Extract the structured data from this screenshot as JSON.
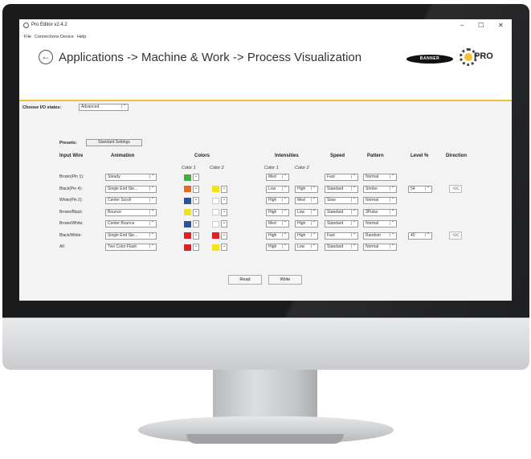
{
  "app": {
    "title": "Pro Editor v2.4.2",
    "window_controls": [
      "–",
      "☐",
      "✕"
    ],
    "menu": [
      "File",
      "Connections",
      "Device",
      "Help"
    ]
  },
  "header": {
    "breadcrumb": "Applications -> Machine & Work -> Process Visualization",
    "banner_logo": "BANNER",
    "pro_logo": "PRO",
    "accent_color": "#f1c232"
  },
  "io_states": {
    "label": "Choose I/O states:",
    "value": "Advanced"
  },
  "presets": {
    "label": "Presets:",
    "value": "Standard Settings"
  },
  "columns": {
    "input_wire": "Input Wire",
    "animation": "Animation",
    "colors": "Colors",
    "color1": "Color 1",
    "color2": "Color 2",
    "intensities": "Intensities",
    "int_color1": "Color 1",
    "int_color2": "Color 2",
    "speed": "Speed",
    "pattern": "Pattern",
    "level": "Level %",
    "direction": "Direction"
  },
  "rows": [
    {
      "wire": "Brown(Pin 1):",
      "animation": "Steady",
      "color1": "#3cb043",
      "color2": null,
      "int1": "Med",
      "int2": null,
      "speed": "Fast",
      "pattern": "Normal",
      "level": null,
      "direction": null
    },
    {
      "wire": "Black(Pin 4):",
      "animation": "Single End Ste...",
      "color1": "#e86a1e",
      "color2": "#f2e21a",
      "int1": "Low",
      "int2": "High",
      "speed": "Standard",
      "pattern": "Strobe",
      "level": "54",
      "direction": "<<"
    },
    {
      "wire": "White(Pin 2):",
      "animation": "Center Scroll",
      "color1": "#2a4fa3",
      "color2": "#ffffff",
      "int1": "High",
      "int2": "Med",
      "speed": "Slow",
      "pattern": "Normal",
      "level": null,
      "direction": null
    },
    {
      "wire": "Brown/Black:",
      "animation": "Bounce",
      "color1": "#f2e21a",
      "color2": "#ffffff",
      "int1": "High",
      "int2": "Low",
      "speed": "Standard",
      "pattern": "3Pulse",
      "level": null,
      "direction": null
    },
    {
      "wire": "Brown/White:",
      "animation": "Center Bounce",
      "color1": "#2a4fa3",
      "color2": "#ffffff",
      "int1": "Med",
      "int2": "High",
      "speed": "Standard",
      "pattern": "Normal",
      "level": null,
      "direction": null
    },
    {
      "wire": "Black/White:",
      "animation": "Single End Ste...",
      "color1": "#e02020",
      "color2": "#e02020",
      "int1": "High",
      "int2": "High",
      "speed": "Fast",
      "pattern": "Random",
      "level": "40",
      "direction": "<<"
    },
    {
      "wire": "All:",
      "animation": "Two Color Flash",
      "color1": "#e02020",
      "color2": "#f2e21a",
      "int1": "High",
      "int2": "Low",
      "speed": "Standard",
      "pattern": "Normal",
      "level": null,
      "direction": null
    }
  ],
  "buttons": {
    "read": "Read",
    "write": "Write"
  }
}
